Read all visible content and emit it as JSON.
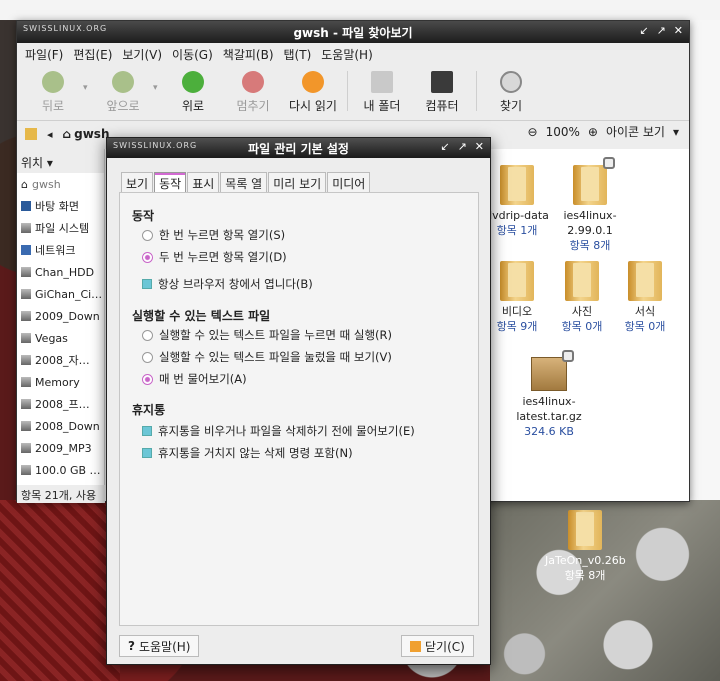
{
  "file_manager": {
    "brand": "SWISSLINUX.ORG",
    "title": "gwsh - 파일 찾아보기",
    "menu": [
      "파일(F)",
      "편집(E)",
      "보기(V)",
      "이동(G)",
      "책갈피(B)",
      "탭(T)",
      "도움말(H)"
    ],
    "toolbar": {
      "back": "뒤로",
      "forward": "앞으로",
      "up": "위로",
      "stop": "멈추기",
      "reload": "다시 읽기",
      "home": "내 폴더",
      "computer": "컴퓨터",
      "search": "찾기"
    },
    "location": "gwsh",
    "zoom": "100%",
    "view_mode": "아이콘 보기",
    "sidebar": {
      "header": "위치",
      "items": [
        "gwsh",
        "바탕 화면",
        "파일 시스템",
        "네트워크",
        "Chan_HDD",
        "GiChan_Ci…",
        "2009_Down",
        "Vegas",
        "2008_자…",
        "Memory",
        "2008_프…",
        "2008_Down",
        "2009_MP3",
        "100.0 GB …"
      ]
    },
    "status": "항목 21개, 사용",
    "files": [
      {
        "name": "dvdrip-data",
        "meta": "항목 1개"
      },
      {
        "name": "ies4linux-2.99.0.1",
        "meta": "항목 8개"
      },
      {
        "name": "비디오",
        "meta": "항목 9개"
      },
      {
        "name": "사진",
        "meta": "항목 0개"
      },
      {
        "name": "서식",
        "meta": "항목 0개"
      },
      {
        "name": "ies4linux-latest.tar.gz",
        "meta": "324.6 KB"
      }
    ]
  },
  "desktop": {
    "icon_name": "JaTeOn_v0.26b",
    "icon_meta": "항목 8개"
  },
  "dialog": {
    "brand": "SWISSLINUX.ORG",
    "title": "파일 관리 기본 설정",
    "tabs": [
      "보기",
      "동작",
      "표시",
      "목록 열",
      "미리 보기",
      "미디어"
    ],
    "sections": {
      "behavior": "동작",
      "executable": "실행할 수 있는 텍스트 파일",
      "trash": "휴지통"
    },
    "options": {
      "single_click": "한 번 누르면 항목 열기(S)",
      "double_click": "두 번 누르면 항목 열기(D)",
      "always_browser": "항상 브라우저 창에서 엽니다(B)",
      "run_exec": "실행할 수 있는 텍스트 파일을 누르면 때 실행(R)",
      "view_exec": "실행할 수 있는 텍스트 파일을 눌렀을 때 보기(V)",
      "ask_exec": "매 번 물어보기(A)",
      "ask_trash": "휴지통을 비우거나 파일을 삭제하기 전에 물어보기(E)",
      "include_delete": "휴지통을 거치지 않는 삭제 명령 포함(N)"
    },
    "help_button": "도움말(H)",
    "close_button": "닫기(C)"
  }
}
